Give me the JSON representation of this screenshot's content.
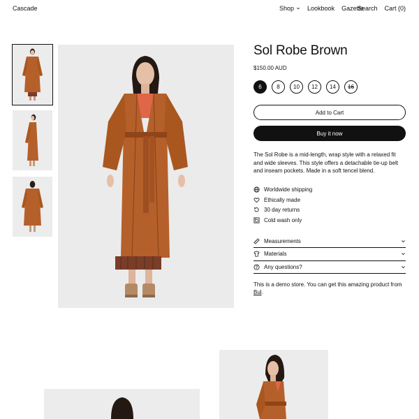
{
  "brand": "Cascade",
  "nav": {
    "shop": "Shop",
    "lookbook": "Lookbook",
    "gazette": "Gazette"
  },
  "utility": {
    "search": "Search",
    "cart": "Cart (0)"
  },
  "product": {
    "title": "Sol Robe Brown",
    "price": "$150.00 AUD",
    "sizes": [
      "6",
      "8",
      "10",
      "12",
      "14",
      "16"
    ],
    "selected_size": "6",
    "soldout_size": "16",
    "add_to_cart": "Add to Cart",
    "buy_now": "Buy it now",
    "description": "The Sol Robe is a mid-length, wrap style with a relaxed fit and wide sleeves. This style offers a detachable tie-up belt and inseam pockets. Made in a soft tencel blend.",
    "features": [
      {
        "icon": "globe-icon",
        "label": "Worldwide shipping"
      },
      {
        "icon": "heart-icon",
        "label": "Ethically made"
      },
      {
        "icon": "return-icon",
        "label": "30 day returns"
      },
      {
        "icon": "wash-icon",
        "label": "Cold wash only"
      }
    ],
    "accordion": [
      {
        "icon": "ruler-icon",
        "label": "Measurements"
      },
      {
        "icon": "shirt-icon",
        "label": "Materials"
      },
      {
        "icon": "question-icon",
        "label": "Any questions?"
      }
    ],
    "note_text": "This is a demo store. You can get this amazing product from",
    "note_link": "Bul",
    "note_end": "."
  },
  "colors": {
    "robe": "#b5602a",
    "robe_dark": "#8e4519",
    "background": "#ebebeb",
    "accent": "#111111"
  }
}
